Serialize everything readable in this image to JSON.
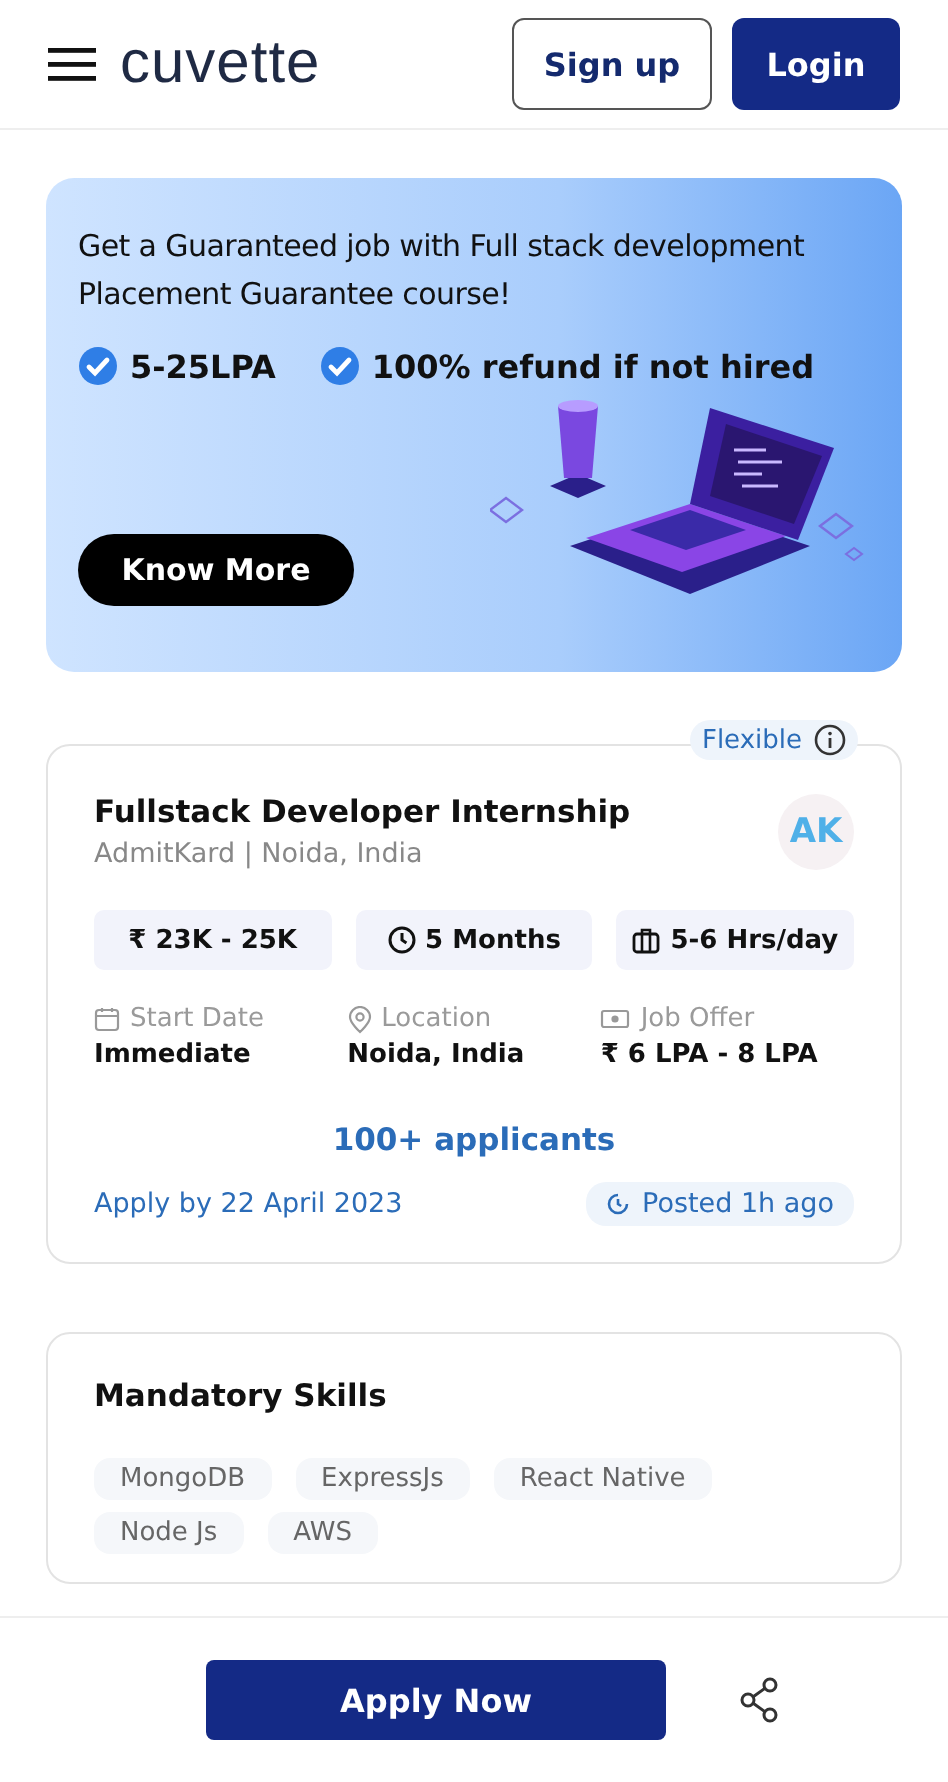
{
  "header": {
    "logo": "cuvette",
    "buttons": [
      {
        "label": "Sign up",
        "kind": "outline"
      },
      {
        "label": "Login",
        "kind": "filled"
      }
    ]
  },
  "banner": {
    "headline": "Get a Guaranteed job with Full stack development Placement Guarantee course!",
    "perks": [
      "5-25LPA",
      "100% refund if not hired"
    ],
    "button": "Know More"
  },
  "job": {
    "badge": "Flexible",
    "title": "Fullstack Developer Internship",
    "company": "AdmitKard | Noida, India",
    "logo_text": "AK",
    "chips": [
      {
        "kind": "stipend",
        "label": "₹ 23K - 25K"
      },
      {
        "kind": "duration",
        "label": "5 Months"
      },
      {
        "kind": "hours",
        "label": "5-6 Hrs/day"
      }
    ],
    "details": [
      {
        "kind": "calendar",
        "label": "Start Date",
        "value": "Immediate"
      },
      {
        "kind": "location",
        "label": "Location",
        "value": "Noida, India"
      },
      {
        "kind": "money",
        "label": "Job Offer",
        "value": "₹ 6 LPA - 8 LPA"
      }
    ],
    "applicants": "100+ applicants",
    "apply_by": "Apply by 22 April 2023",
    "posted": "Posted 1h ago"
  },
  "skills": {
    "title": "Mandatory Skills",
    "items": [
      "MongoDB",
      "ExpressJs",
      "React Native",
      "Node Js",
      "AWS"
    ]
  },
  "footer": {
    "button": "Apply Now"
  }
}
